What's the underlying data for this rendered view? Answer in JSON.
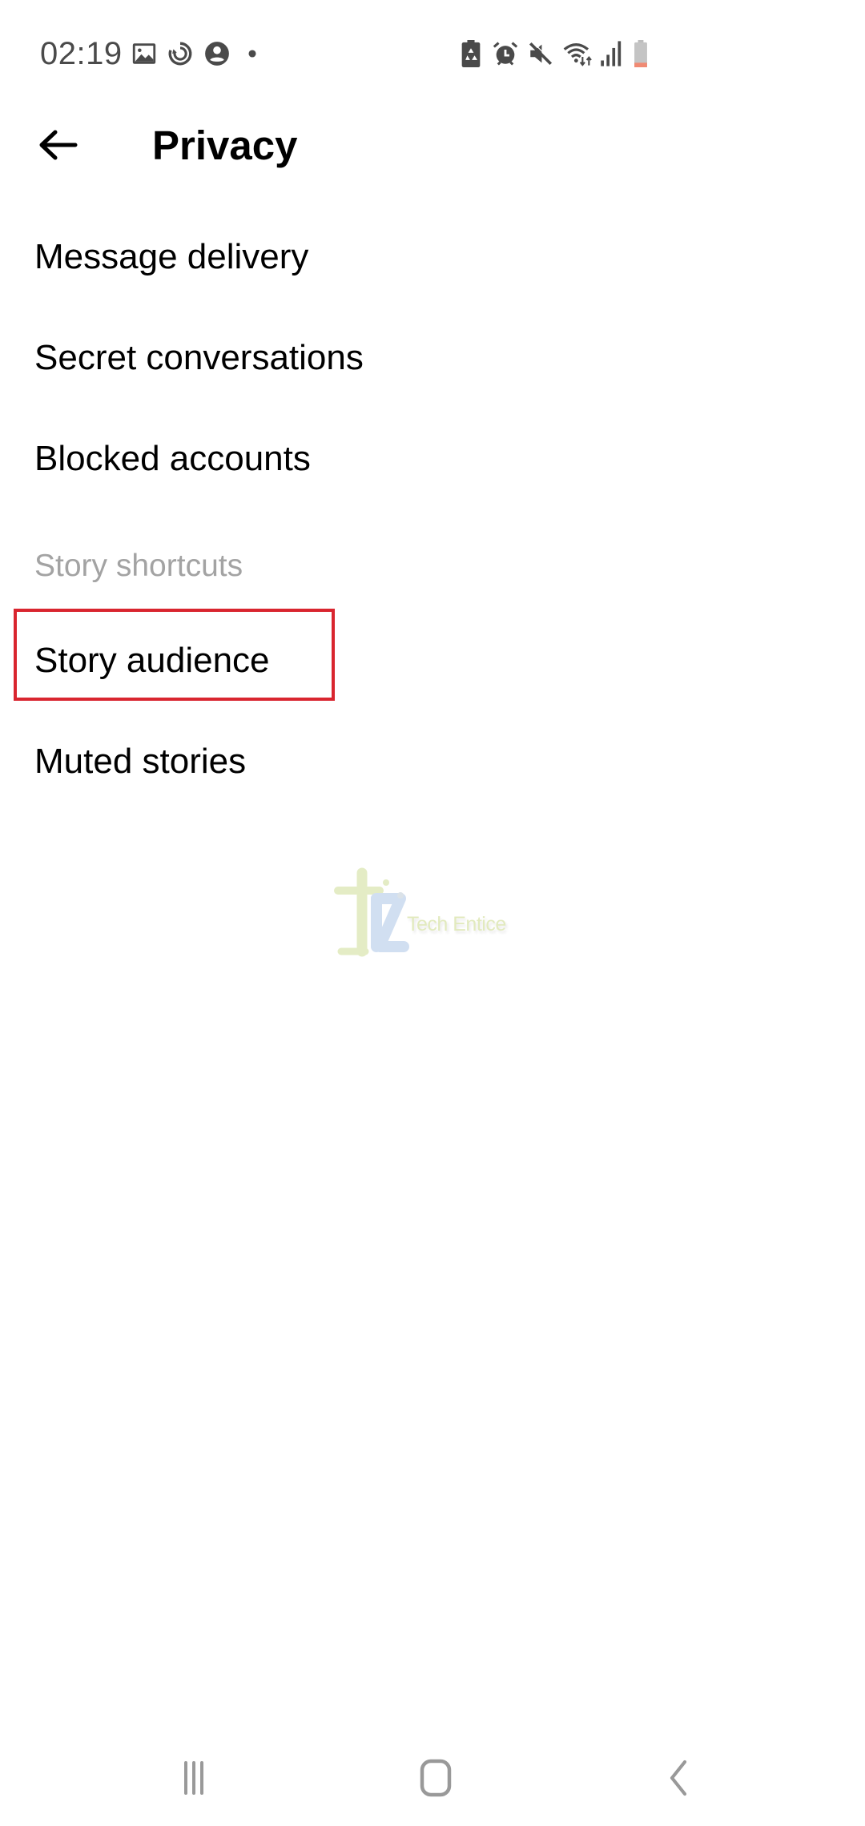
{
  "status_bar": {
    "time": "02:19",
    "left_icons": [
      "gallery-icon",
      "sync-icon",
      "account-icon",
      "notification-dot-icon"
    ],
    "right_icons": [
      "battery-saver-icon",
      "alarm-icon",
      "mute-icon",
      "wifi-icon",
      "signal-icon",
      "battery-low-icon"
    ],
    "battery_level": 0.15,
    "battery_color": "#f08a73"
  },
  "header": {
    "back_icon": "arrow-left-icon",
    "title": "Privacy"
  },
  "menu": {
    "items": [
      {
        "label": "Message delivery"
      },
      {
        "label": "Secret conversations"
      },
      {
        "label": "Blocked accounts"
      }
    ],
    "section_title": "Story shortcuts",
    "story_items": [
      {
        "label": "Story audience",
        "highlighted": true
      },
      {
        "label": "Muted stories",
        "highlighted": false
      }
    ]
  },
  "annotation": {
    "highlight_color": "#d9252f",
    "highlighted_item": "Story audience"
  },
  "watermark": {
    "text": "Tech Entice"
  },
  "nav_bar": {
    "recents_icon": "recent-apps-icon",
    "home_icon": "home-icon",
    "back_icon": "back-icon"
  }
}
